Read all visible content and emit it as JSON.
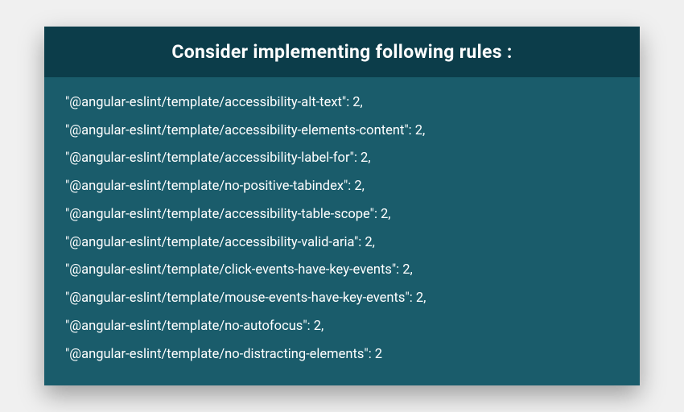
{
  "card": {
    "title": "Consider implementing following rules :",
    "rules": [
      "\"@angular-eslint/template/accessibility-alt-text\": 2,",
      "\"@angular-eslint/template/accessibility-elements-content\": 2,",
      "\"@angular-eslint/template/accessibility-label-for\": 2,",
      "\"@angular-eslint/template/no-positive-tabindex\": 2,",
      "\"@angular-eslint/template/accessibility-table-scope\": 2,",
      "\"@angular-eslint/template/accessibility-valid-aria\": 2,",
      "\"@angular-eslint/template/click-events-have-key-events\": 2,",
      "\"@angular-eslint/template/mouse-events-have-key-events\": 2,",
      "\"@angular-eslint/template/no-autofocus\": 2,",
      "\"@angular-eslint/template/no-distracting-elements\": 2"
    ]
  }
}
